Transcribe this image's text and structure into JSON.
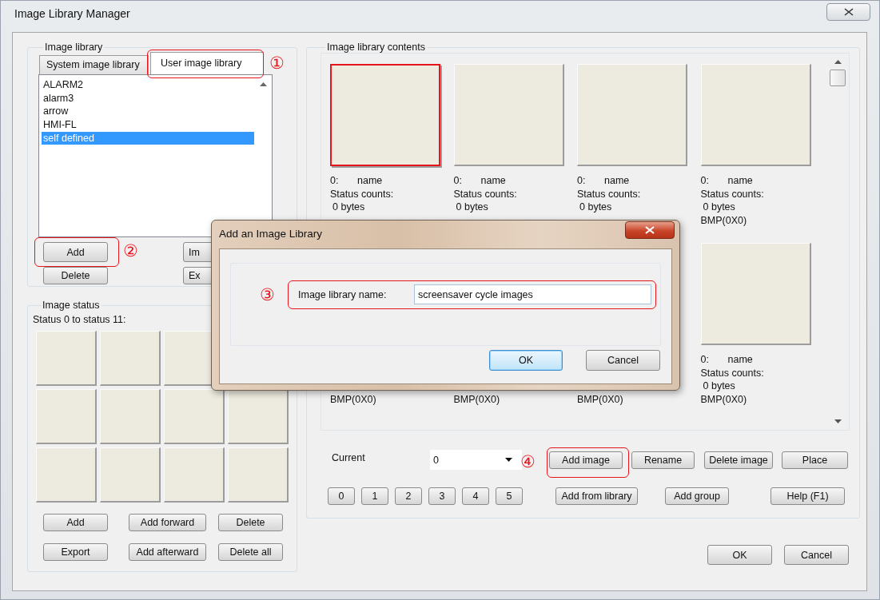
{
  "window": {
    "title": "Image Library Manager"
  },
  "image_library": {
    "title": "Image library",
    "tabs": [
      {
        "label": "System image library",
        "selected": false
      },
      {
        "label": "User image library",
        "selected": true
      }
    ],
    "items": [
      {
        "label": "ALARM2",
        "selected": false
      },
      {
        "label": "alarm3",
        "selected": false
      },
      {
        "label": "arrow",
        "selected": false
      },
      {
        "label": "HMI-FL",
        "selected": false
      },
      {
        "label": "self defined",
        "selected": true
      }
    ],
    "buttons": [
      "Add",
      "Delete"
    ],
    "partial_buttons": [
      "Im",
      "Ex"
    ]
  },
  "image_status": {
    "title": "Image status",
    "caption": "Status 0 to status 11:",
    "buttons": [
      "Add",
      "Add forward",
      "Delete",
      "Export",
      "Add afterward",
      "Delete all"
    ]
  },
  "contents": {
    "title": "Image library contents",
    "cards": [
      {
        "thumbnail": {
          "selected": true
        },
        "index": "0:",
        "name": "name",
        "status": "Status counts:",
        "size": "0 bytes"
      },
      {
        "thumbnail": {
          "selected": false
        },
        "index": "0:",
        "name": "name",
        "status": "Status counts:",
        "size": "0 bytes"
      },
      {
        "thumbnail": {
          "selected": false
        },
        "index": "0:",
        "name": "name",
        "status": "Status counts:",
        "size": "0 bytes"
      },
      {
        "thumbnail": {
          "selected": false
        },
        "index": "0:",
        "name": "name",
        "status": "Status counts:",
        "size": "0 bytes",
        "format": "BMP(0X0)"
      },
      {
        "format": "BMP(0X0)"
      },
      {
        "format": "BMP(0X0)"
      },
      {
        "format": "BMP(0X0)"
      },
      {
        "thumbnail": {
          "selected": false
        },
        "index": "0:",
        "name": "name",
        "status": "Status counts:",
        "size": "0 bytes",
        "format": "BMP(0X0)"
      }
    ],
    "current_label": "Current",
    "current_value": "0",
    "actions": [
      "Add image",
      "Rename",
      "Delete image",
      "Place"
    ],
    "status_buttons": [
      "0",
      "1",
      "2",
      "3",
      "4",
      "5"
    ],
    "more_actions": [
      "Add from library",
      "Add group",
      "Help (F1)"
    ]
  },
  "footer_buttons": [
    "OK",
    "Cancel"
  ],
  "dialog": {
    "title": "Add an Image Library",
    "field_label": "Image library name:",
    "field_value": "screensaver cycle images",
    "buttons": [
      {
        "label": "OK",
        "focused": true
      },
      {
        "label": "Cancel",
        "focused": false
      }
    ]
  },
  "annotations": [
    "①",
    "②",
    "③",
    "④"
  ]
}
